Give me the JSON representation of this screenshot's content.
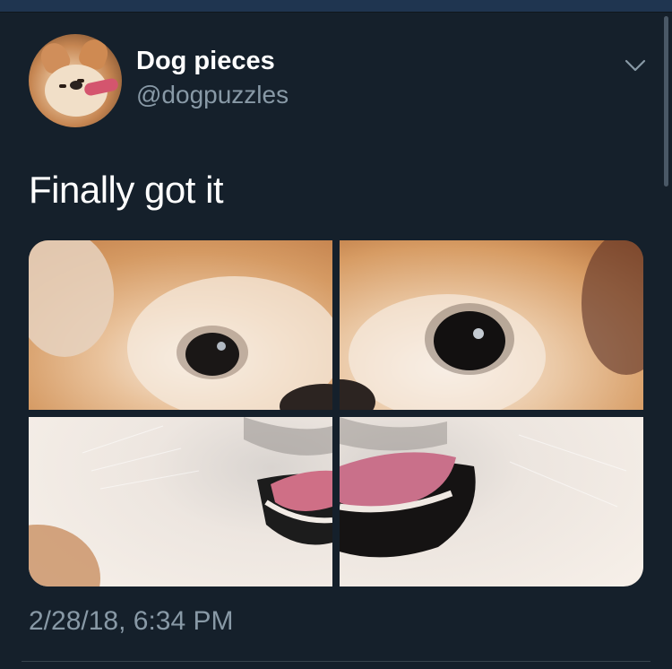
{
  "tweet": {
    "display_name": "Dog pieces",
    "handle": "@dogpuzzles",
    "text": "Finally got it",
    "timestamp": "2/28/18, 6:34 PM",
    "media_count": 4
  },
  "icons": {
    "menu": "chevron-down-icon",
    "avatar": "avatar-dog-photo"
  },
  "colors": {
    "background": "#15202b",
    "primary_text": "#ffffff",
    "secondary_text": "#8899a6",
    "divider": "#38444d"
  }
}
